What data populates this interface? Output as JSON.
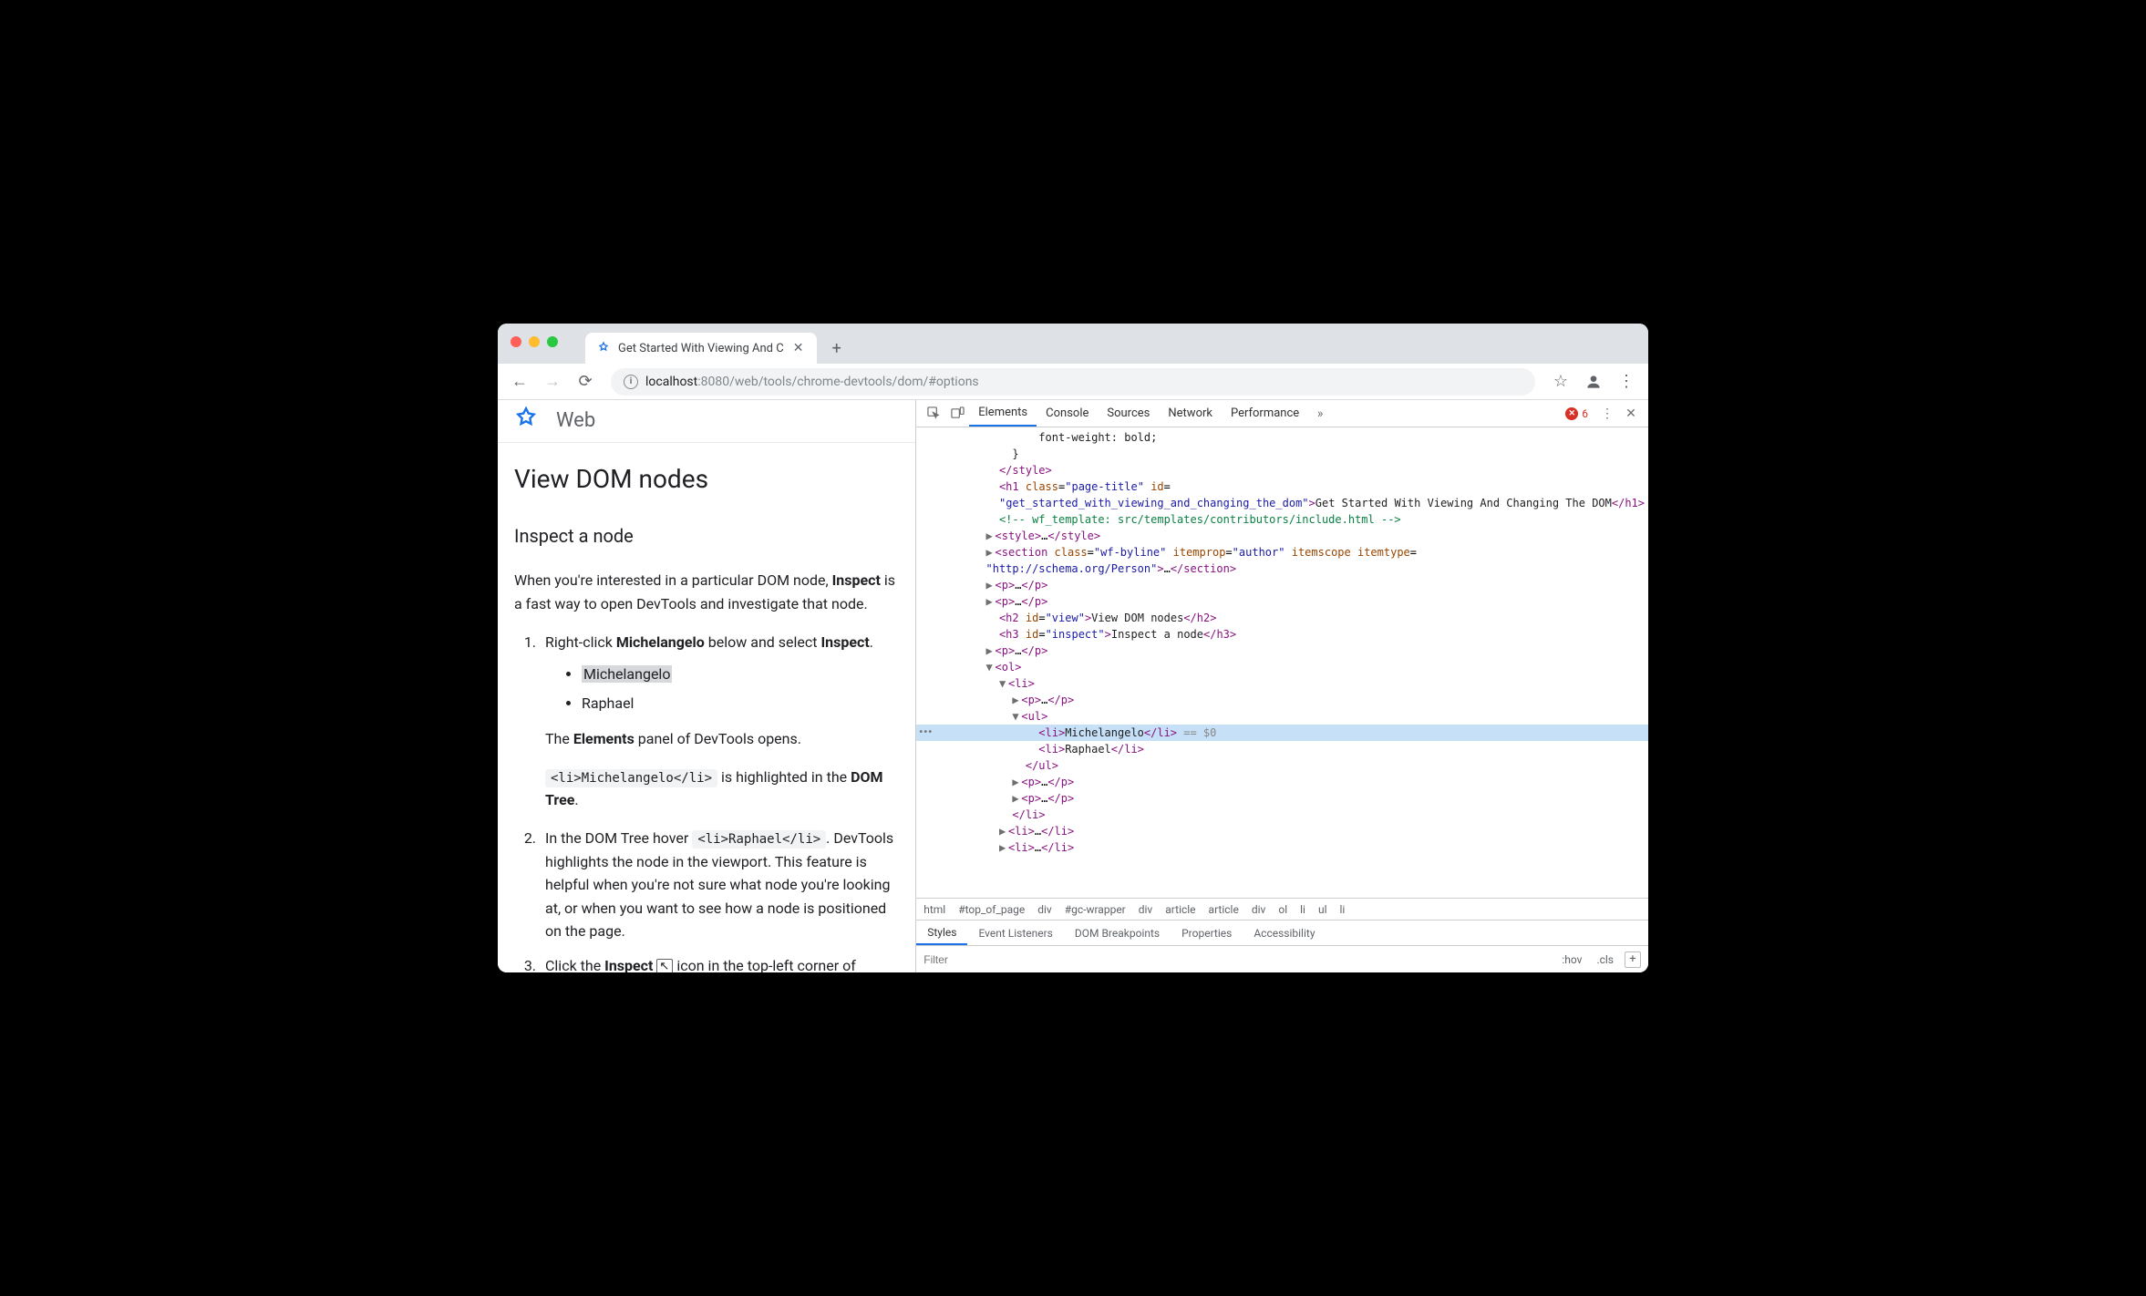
{
  "browser": {
    "tab_title": "Get Started With Viewing And C",
    "address": {
      "host": "localhost",
      "port_path": ":8080/web/tools/chrome-devtools/dom/#options"
    }
  },
  "page": {
    "site_label": "Web",
    "h1": "View DOM nodes",
    "h2": "Inspect a node",
    "intro_prefix": "When you're interested in a particular DOM node, ",
    "intro_bold": "Inspect",
    "intro_suffix": " is a fast way to open DevTools and investigate that node.",
    "steps": {
      "s1_prefix": "Right-click ",
      "s1_bold": "Michelangelo",
      "s1_mid": " below and select ",
      "s1_bold2": "Inspect",
      "s1_suffix": ".",
      "bullets": [
        "Michelangelo",
        "Raphael"
      ],
      "s1b_prefix": "The ",
      "s1b_bold": "Elements",
      "s1b_suffix": " panel of DevTools opens.",
      "s1c_code": "<li>Michelangelo</li>",
      "s1c_mid": " is highlighted in the ",
      "s1c_bold": "DOM Tree",
      "s1c_suffix": ".",
      "s2_prefix": "In the DOM Tree hover ",
      "s2_code": "<li>Raphael</li>",
      "s2_suffix": ". DevTools highlights the node in the viewport. This feature is helpful when you're not sure what node you're looking at, or when you want to see how a node is positioned on the page.",
      "s3_prefix": "Click the ",
      "s3_bold": "Inspect",
      "s3_suffix": " icon in the top-left corner of DevTools"
    }
  },
  "devtools": {
    "tabs": [
      "Elements",
      "Console",
      "Sources",
      "Network",
      "Performance"
    ],
    "active_tab": "Elements",
    "error_count": "6",
    "crumbs": [
      "html",
      "#top_of_page",
      "div",
      "#gc-wrapper",
      "div",
      "article",
      "article",
      "div",
      "ol",
      "li",
      "ul",
      "li"
    ],
    "sub_tabs": [
      "Styles",
      "Event Listeners",
      "DOM Breakpoints",
      "Properties",
      "Accessibility"
    ],
    "active_sub": "Styles",
    "filter_placeholder": "Filter",
    "hov": ":hov",
    "cls": ".cls",
    "tree": {
      "l0": "font-weight: bold;",
      "l1": "}",
      "h1_class": "page-title",
      "h1_id": "get_started_with_viewing_and_changing_the_dom",
      "h1_text": "Get Started With Viewing And Changing The DOM",
      "comment": "<!-- wf_template: src/templates/contributors/include.html -->",
      "section_class": "wf-byline",
      "section_itemprop": "author",
      "section_itemtype": "http://schema.org/Person",
      "h2_id": "view",
      "h2_text": "View DOM nodes",
      "h3_id": "inspect",
      "h3_text": "Inspect a node",
      "li1": "Michelangelo",
      "li2": "Raphael",
      "eqvar": " == $0"
    }
  }
}
